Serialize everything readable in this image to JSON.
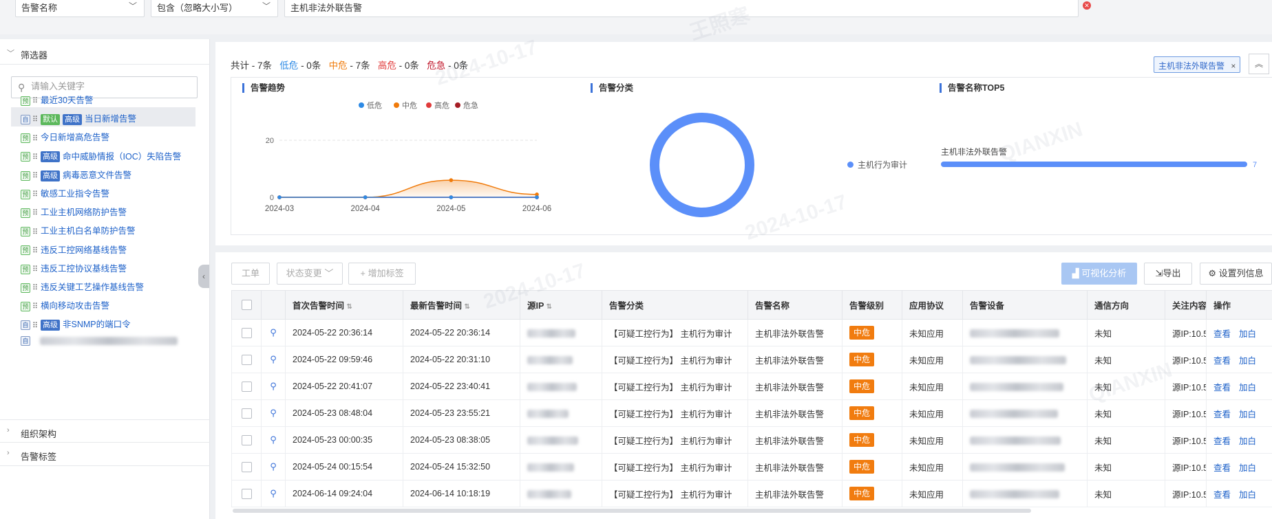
{
  "filter": {
    "field_label": "告警名称",
    "operator_label": "包含（忽略大小写）",
    "value": "主机非法外联告警"
  },
  "sidebar": {
    "filters_title": "筛选器",
    "search_placeholder": "请输入关键字",
    "items": [
      {
        "type": "预",
        "tags": [],
        "label": "最近30天告警"
      },
      {
        "type": "自",
        "tags": [
          "默认",
          "高级"
        ],
        "label": "当日新增告警"
      },
      {
        "type": "预",
        "tags": [],
        "label": "今日新增高危告警"
      },
      {
        "type": "预",
        "tags": [
          "高级"
        ],
        "label": "命中威胁情报（IOC）失陷告警"
      },
      {
        "type": "预",
        "tags": [
          "高级"
        ],
        "label": "病毒恶意文件告警"
      },
      {
        "type": "预",
        "tags": [],
        "label": "敏感工业指令告警"
      },
      {
        "type": "预",
        "tags": [],
        "label": "工业主机网络防护告警"
      },
      {
        "type": "预",
        "tags": [],
        "label": "工业主机白名单防护告警"
      },
      {
        "type": "预",
        "tags": [],
        "label": "违反工控网络基线告警"
      },
      {
        "type": "预",
        "tags": [],
        "label": "违反工控协议基线告警"
      },
      {
        "type": "预",
        "tags": [],
        "label": "违反关键工艺操作基线告警"
      },
      {
        "type": "预",
        "tags": [],
        "label": "横向移动攻击告警"
      },
      {
        "type": "自",
        "tags": [
          "高级"
        ],
        "label": "非SNMP的端口令"
      }
    ],
    "org_title": "组织架构",
    "tags_title": "告警标签"
  },
  "summary": {
    "total_label": "共计 -",
    "total_count": "7条",
    "low_label": "低危",
    "low_count": "- 0条",
    "mid_label": "中危",
    "mid_count": "- 7条",
    "high_label": "高危",
    "high_count": "- 0条",
    "crit_label": "危急",
    "crit_count": "- 0条",
    "chip_label": "主机非法外联告警",
    "chip_close": "×"
  },
  "panels": {
    "trend_title": "告警趋势",
    "category_title": "告警分类",
    "top5_title": "告警名称TOP5"
  },
  "chart_data": [
    {
      "type": "area",
      "title": "告警趋势",
      "x": [
        "2024-03",
        "2024-04",
        "2024-05",
        "2024-06"
      ],
      "ylim": [
        0,
        20
      ],
      "yticks": [
        0,
        20
      ],
      "series": [
        {
          "name": "低危",
          "color": "#2d8ae5",
          "values": [
            0,
            0,
            0,
            0
          ]
        },
        {
          "name": "中危",
          "color": "#f07b0b",
          "values": [
            0,
            0,
            6,
            1
          ]
        },
        {
          "name": "高危",
          "color": "#e03b3b",
          "values": [
            0,
            0,
            0,
            0
          ]
        },
        {
          "name": "危急",
          "color": "#a51d24",
          "values": [
            0,
            0,
            0,
            0
          ]
        }
      ],
      "legend": "top"
    },
    {
      "type": "pie",
      "title": "告警分类",
      "slices": [
        {
          "name": "主机行为审计",
          "value": 7,
          "color": "#5b8ff9"
        }
      ],
      "donut": true
    },
    {
      "type": "bar",
      "title": "告警名称TOP5",
      "orientation": "horizontal",
      "categories": [
        "主机非法外联告警"
      ],
      "values": [
        7
      ],
      "color": "#5b8ff9"
    }
  ],
  "toolbar": {
    "workorder": "工单",
    "status_change": "状态变更",
    "add_tag": "增加标签",
    "visual_analysis": "可视化分析",
    "export": "导出",
    "column_settings": "设置列信息"
  },
  "table": {
    "headers": [
      "首次告警时间",
      "最新告警时间",
      "源IP",
      "告警分类",
      "告警名称",
      "告警级别",
      "应用协议",
      "告警设备",
      "通信方向",
      "关注内容",
      "操作"
    ],
    "rows": [
      {
        "first": "2024-05-22 20:36:14",
        "last": "2024-05-22 20:36:14",
        "category": "【可疑工控行为】 主机行为审计",
        "name": "主机非法外联告警",
        "level": "中危",
        "protocol": "未知应用",
        "direction": "未知",
        "focus": "源IP:10.5"
      },
      {
        "first": "2024-05-22 09:59:46",
        "last": "2024-05-22 20:31:10",
        "category": "【可疑工控行为】 主机行为审计",
        "name": "主机非法外联告警",
        "level": "中危",
        "protocol": "未知应用",
        "direction": "未知",
        "focus": "源IP:10.5"
      },
      {
        "first": "2024-05-22 20:41:07",
        "last": "2024-05-22 23:40:41",
        "category": "【可疑工控行为】 主机行为审计",
        "name": "主机非法外联告警",
        "level": "中危",
        "protocol": "未知应用",
        "direction": "未知",
        "focus": "源IP:10.5"
      },
      {
        "first": "2024-05-23 08:48:04",
        "last": "2024-05-23 23:55:21",
        "category": "【可疑工控行为】 主机行为审计",
        "name": "主机非法外联告警",
        "level": "中危",
        "protocol": "未知应用",
        "direction": "未知",
        "focus": "源IP:10.5"
      },
      {
        "first": "2024-05-23 00:00:35",
        "last": "2024-05-23 08:38:05",
        "category": "【可疑工控行为】 主机行为审计",
        "name": "主机非法外联告警",
        "level": "中危",
        "protocol": "未知应用",
        "direction": "未知",
        "focus": "源IP:10.5"
      },
      {
        "first": "2024-05-24 00:15:54",
        "last": "2024-05-24 15:32:50",
        "category": "【可疑工控行为】 主机行为审计",
        "name": "主机非法外联告警",
        "level": "中危",
        "protocol": "未知应用",
        "direction": "未知",
        "focus": "源IP:10.5"
      },
      {
        "first": "2024-06-14 09:24:04",
        "last": "2024-06-14 10:18:19",
        "category": "【可疑工控行为】 主机行为审计",
        "name": "主机非法外联告警",
        "level": "中危",
        "protocol": "未知应用",
        "direction": "未知",
        "focus": "源IP:10.5"
      }
    ],
    "action_view": "查看",
    "action_add": "加白"
  },
  "watermark": {
    "date": "2024-10-17",
    "name": "王照寒",
    "org": "QIANXIN"
  }
}
